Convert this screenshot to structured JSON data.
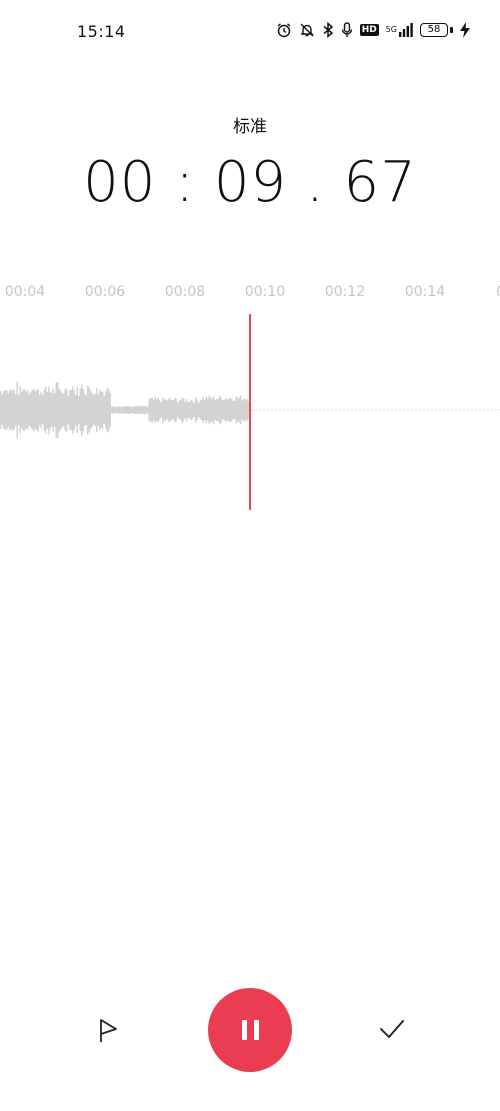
{
  "status_bar": {
    "time": "15:14",
    "network_label": "5G",
    "hd_label": "HD",
    "battery_level": "58",
    "icons": [
      "alarm-icon",
      "mute-icon",
      "bluetooth-icon",
      "mic-icon",
      "hd-icon",
      "signal-icon",
      "battery-icon",
      "charging-icon"
    ]
  },
  "recorder": {
    "mode": "标准",
    "elapsed": "00 : 09 . 67"
  },
  "timeline": {
    "ticks": [
      "00:04",
      "00:06",
      "00:08",
      "00:10",
      "00:12",
      "00:14",
      "00"
    ]
  },
  "controls": {
    "flag_icon": "flag-icon",
    "pause_icon": "pause-icon",
    "done_icon": "check-icon",
    "accent_color": "#ea3d52"
  }
}
